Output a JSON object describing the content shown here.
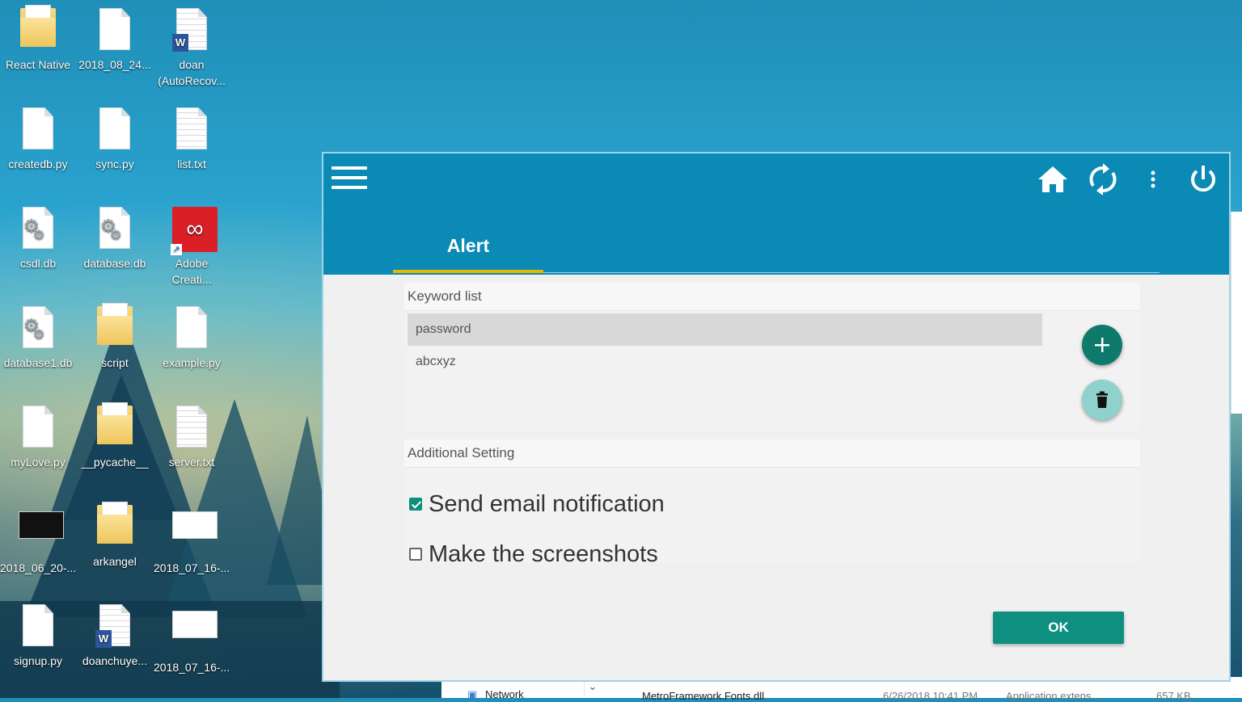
{
  "desktop": {
    "icons": [
      {
        "label": "React Native",
        "icon": "folder-icon"
      },
      {
        "label": "2018_08_24...",
        "icon": "file-icon"
      },
      {
        "label": "doan\n(AutoRecov...",
        "icon": "word-doc-icon"
      },
      {
        "label": "createdb.py",
        "icon": "file-icon"
      },
      {
        "label": "sync.py",
        "icon": "file-icon"
      },
      {
        "label": "list.txt",
        "icon": "text-file-icon"
      },
      {
        "label": "csdl.db",
        "icon": "settings-file-icon"
      },
      {
        "label": "database.db",
        "icon": "settings-file-icon"
      },
      {
        "label": "Adobe\nCreati...",
        "icon": "adobe-cc-icon"
      },
      {
        "label": "database1.db",
        "icon": "settings-file-icon"
      },
      {
        "label": "script",
        "icon": "folder-icon"
      },
      {
        "label": "example.py",
        "icon": "file-icon"
      },
      {
        "label": "myLove.py",
        "icon": "file-icon"
      },
      {
        "label": "__pycache__",
        "icon": "folder-icon"
      },
      {
        "label": "server.txt",
        "icon": "text-file-icon"
      },
      {
        "label": "2018_06_20-...",
        "icon": "video-thumbnail-icon"
      },
      {
        "label": "arkangel",
        "icon": "folder-icon"
      },
      {
        "label": "2018_07_16-...",
        "icon": "image-thumbnail-icon"
      },
      {
        "label": "signup.py",
        "icon": "file-icon"
      },
      {
        "label": "doanchuye...",
        "icon": "word-doc-icon"
      },
      {
        "label": "2018_07_16-...",
        "icon": "image-thumbnail-icon"
      }
    ]
  },
  "explorer": {
    "nav_item": "Network",
    "file_name": "MetroFramework.Fonts.dll",
    "file_date": "6/26/2018 10:41 PM",
    "file_type": "Application extens...",
    "file_size": "657 KB"
  },
  "app": {
    "toolbar": {
      "menu_icon": "hamburger-menu-icon",
      "home_icon": "home-icon",
      "sync_icon": "sync-icon",
      "more_icon": "more-vertical-icon",
      "power_icon": "power-icon"
    },
    "tab": {
      "label": "Alert",
      "accent": "#e6b800"
    },
    "keyword_section": {
      "title": "Keyword list",
      "items": [
        "password",
        "abcxyz"
      ],
      "selected_index": 0
    },
    "additional_section": {
      "title": "Additional Setting",
      "options": [
        {
          "label": "Send email notification",
          "checked": true
        },
        {
          "label": "Make the screenshots",
          "checked": false
        }
      ]
    },
    "ok_label": "OK",
    "colors": {
      "header": "#0a8ab5",
      "accent": "#0e8f80",
      "tab_underline": "#e6b800"
    }
  }
}
